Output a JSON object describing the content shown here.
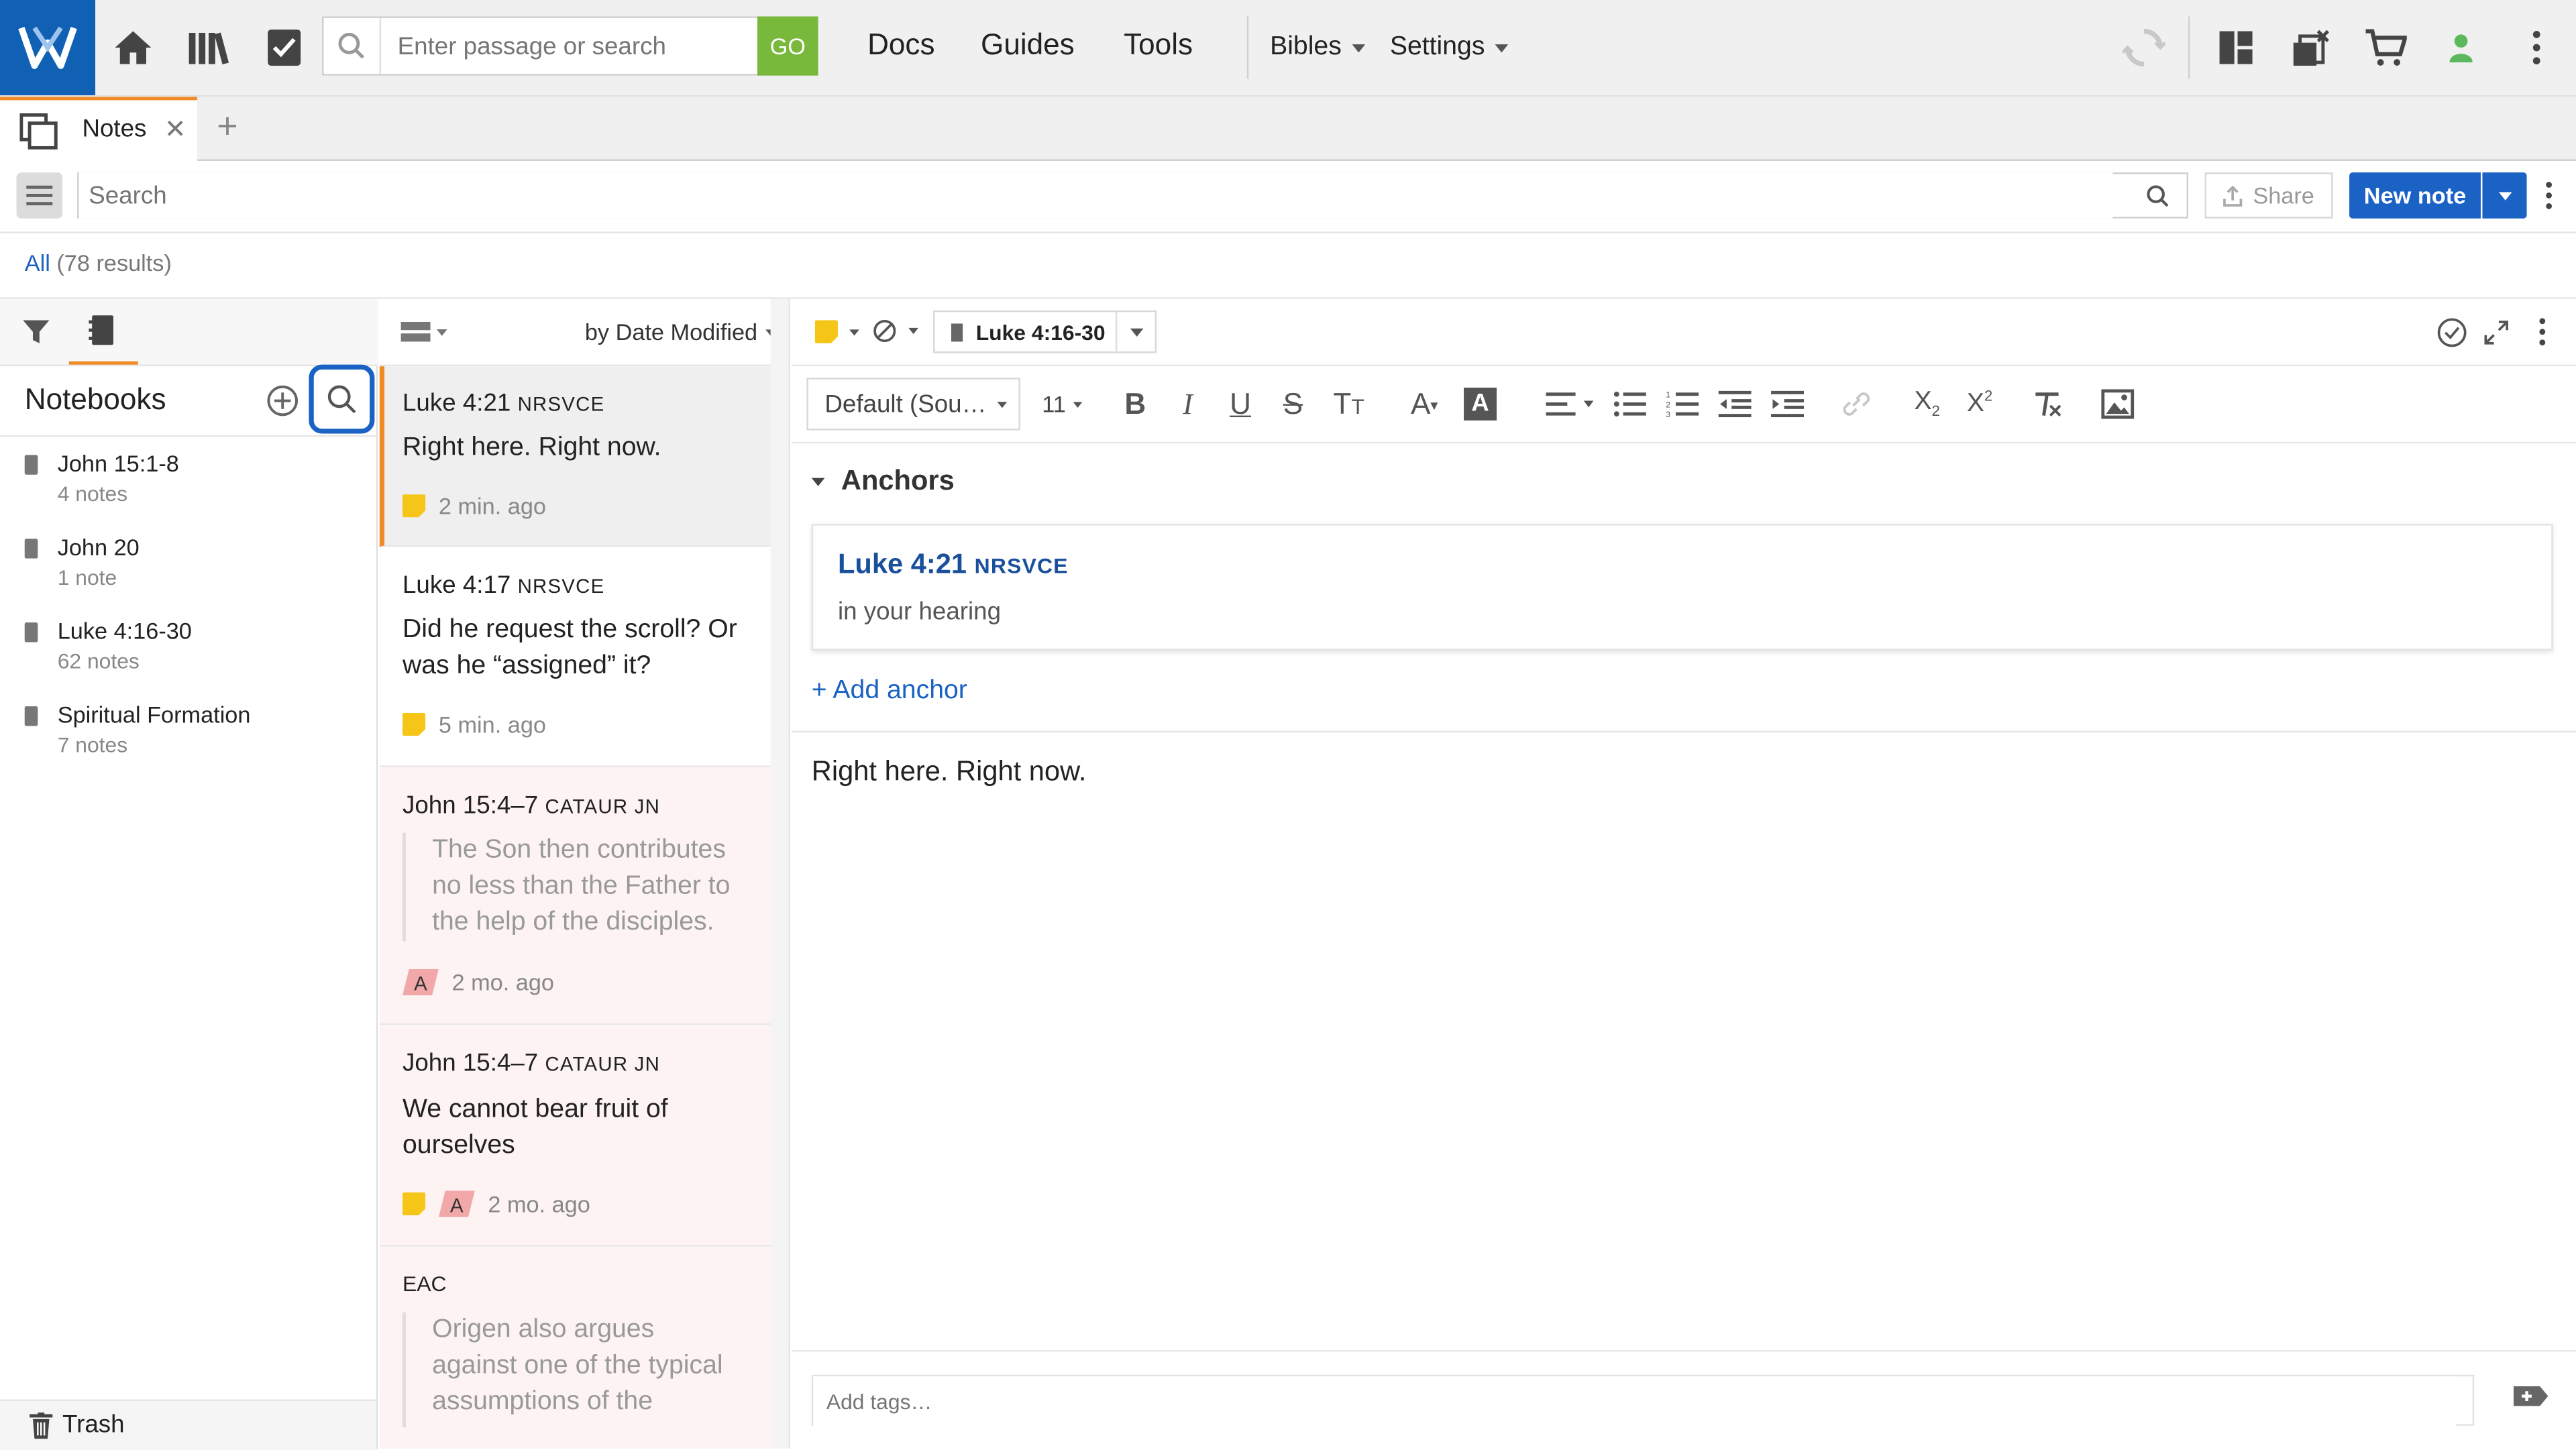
{
  "topbar": {
    "search_placeholder": "Enter passage or search",
    "go_label": "GO",
    "nav": [
      "Docs",
      "Guides",
      "Tools"
    ],
    "bibles_label": "Bibles",
    "settings_label": "Settings"
  },
  "tab": {
    "label": "Notes"
  },
  "toolbar": {
    "search_placeholder": "Search",
    "share_label": "Share",
    "new_note_label": "New note"
  },
  "results": {
    "all_label": "All",
    "count_label": "(78 results)"
  },
  "notebooks": {
    "title": "Notebooks",
    "items": [
      {
        "name": "John 15:1-8",
        "count": "4 notes"
      },
      {
        "name": "John 20",
        "count": "1 note"
      },
      {
        "name": "Luke 4:16-30",
        "count": "62 notes"
      },
      {
        "name": "Spiritual Formation",
        "count": "7 notes"
      }
    ],
    "trash_label": "Trash"
  },
  "list": {
    "sort_label": "by Date Modified",
    "notes": [
      {
        "ref": "Luke 4:21",
        "version": "NRSVCE",
        "title": "Right here. Right now.",
        "time": "2 min. ago"
      },
      {
        "ref": "Luke 4:17",
        "version": "NRSVCE",
        "title": "Did he request the scroll? Or was he “assigned” it?",
        "time": "5 min. ago"
      },
      {
        "ref": "John 15:4–7",
        "version": "CATAUR JN",
        "quote": "The Son then contributes no less than the Father to the help of the disciples.",
        "time": "2 mo. ago"
      },
      {
        "ref": "John 15:4–7",
        "version": "CATAUR JN",
        "title": "We cannot bear fruit of ourselves",
        "time": "2 mo. ago"
      },
      {
        "ref": "EAC",
        "quote": "Origen also argues against one of the typical assumptions of the"
      }
    ]
  },
  "editor": {
    "anchor_chip": "Luke 4:16-30",
    "font_label": "Default (Sou…",
    "size_label": "11",
    "anchors_heading": "Anchors",
    "anchor": {
      "ref": "Luke 4:21",
      "version": "NRSVCE",
      "text": "in your hearing"
    },
    "add_anchor_label": "+ Add anchor",
    "body": "Right here. Right now.",
    "tags_placeholder": "Add tags…"
  },
  "colors": {
    "brand": "#1060b4",
    "accent": "#f08a24",
    "primary_button": "#1a62c4",
    "go_button": "#78b83a",
    "sticky_note": "#f5c518",
    "status_dot": "#5cb85c"
  }
}
